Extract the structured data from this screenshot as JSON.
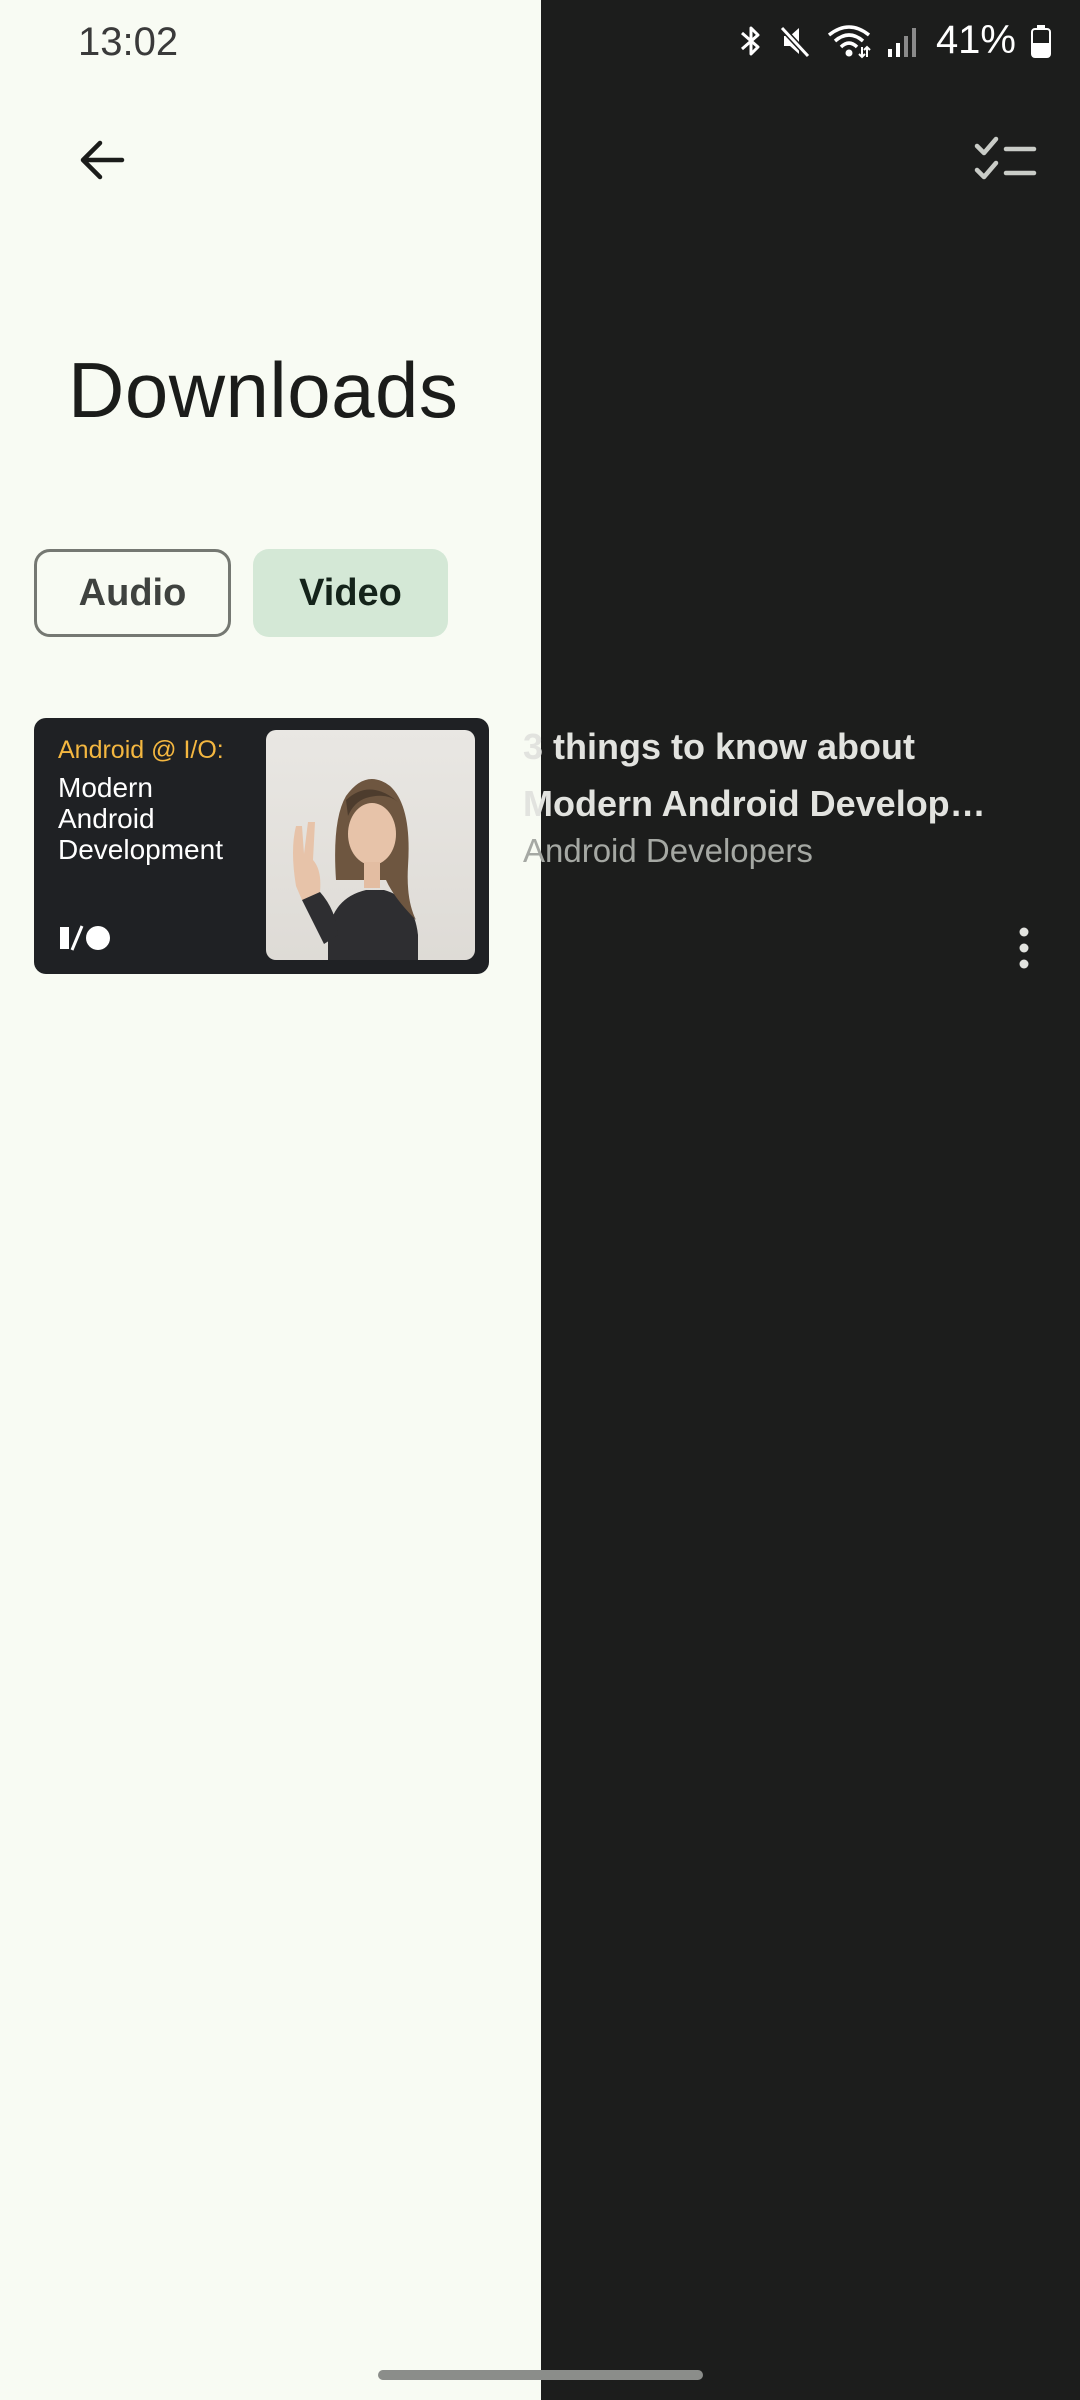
{
  "status_bar": {
    "time": "13:02",
    "battery_percent": "41%",
    "icons": [
      "bluetooth-icon",
      "mute-icon",
      "wifi-icon",
      "signal-icon",
      "battery-icon"
    ]
  },
  "toolbar": {
    "back_icon": "arrow-back-icon",
    "select_icon": "checklist-icon"
  },
  "page": {
    "title": "Downloads"
  },
  "filters": {
    "chips": [
      {
        "label": "Audio",
        "selected": false
      },
      {
        "label": "Video",
        "selected": true
      }
    ]
  },
  "downloads": [
    {
      "thumbnail": {
        "tag": "Android @ I/O:",
        "headline": "Modern\nAndroid\nDevelopment"
      },
      "title_line1": "3 things to know about",
      "title_line2": "Modern Android Develop…",
      "channel": "Android Developers",
      "menu_icon": "more-vert-icon"
    }
  ],
  "colors": {
    "light_bg": "#f8fbf3",
    "dark_bg": "#1c1d1c",
    "chip_selected_bg": "#d4e8d6",
    "thumbnail_tag": "#f4b740"
  }
}
